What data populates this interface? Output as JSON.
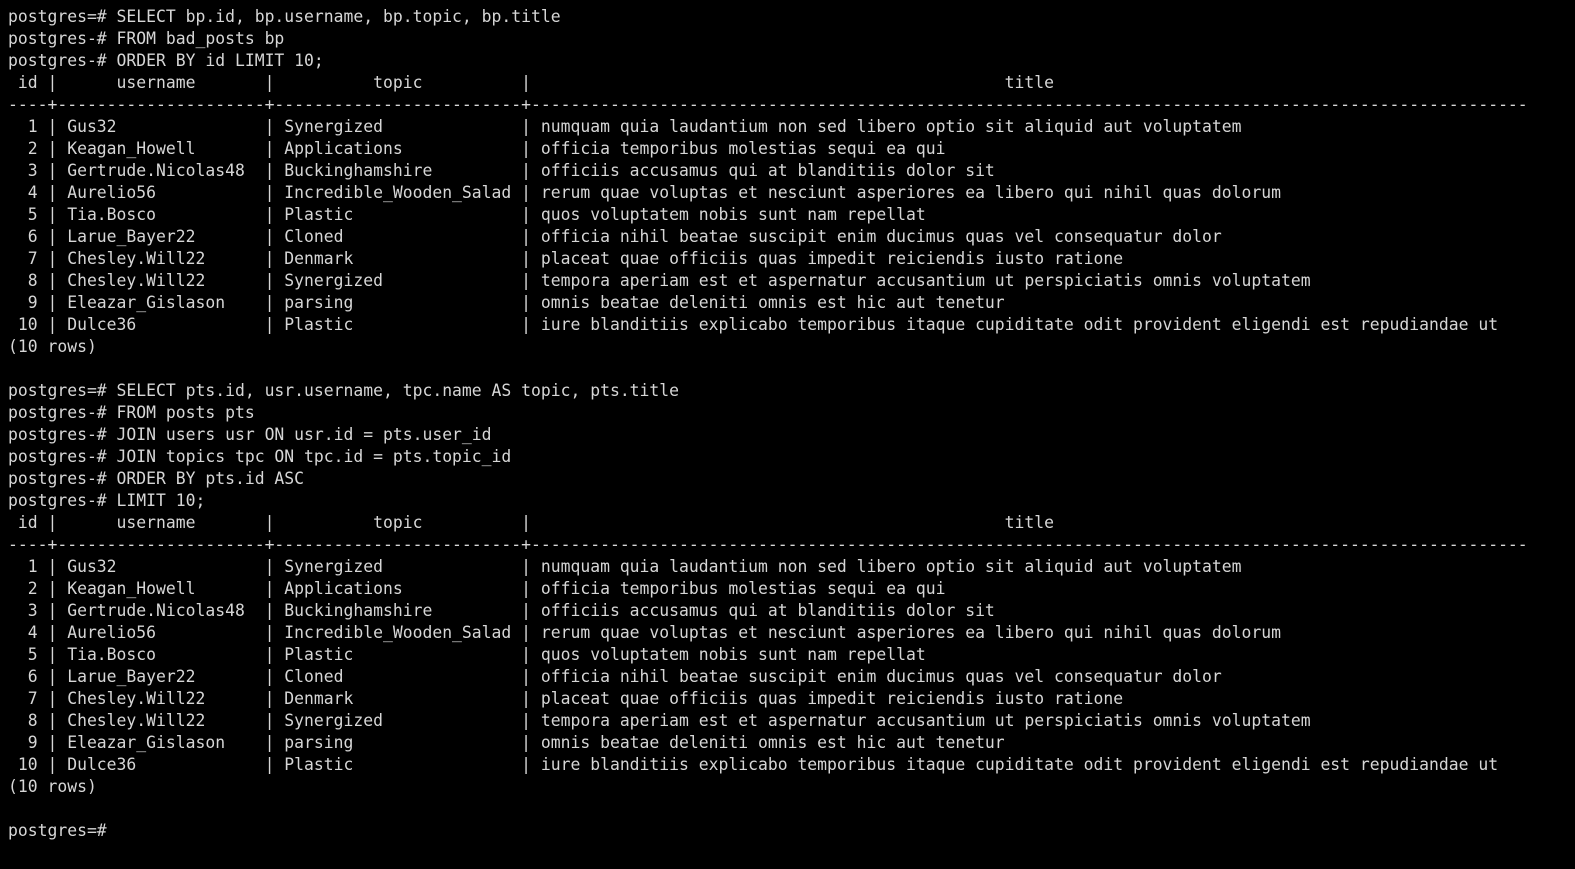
{
  "terminal": {
    "colors": {
      "background": "#000000",
      "foreground": "#d6d6d6"
    },
    "prompt_primary": "postgres=#",
    "prompt_continuation": "postgres-#",
    "column_widths": {
      "id": 4,
      "username": 21,
      "topic": 25
    },
    "separator_total_width": 154
  },
  "blocks": [
    {
      "name": "bad-posts-query",
      "query_lines": [
        "postgres=# SELECT bp.id, bp.username, bp.topic, bp.title",
        "postgres-# FROM bad_posts bp",
        "postgres-# ORDER BY id LIMIT 10;"
      ],
      "result": {
        "headers": [
          "id",
          "username",
          "topic",
          "title"
        ],
        "rows": [
          [
            "1",
            "Gus32",
            "Synergized",
            "numquam quia laudantium non sed libero optio sit aliquid aut voluptatem"
          ],
          [
            "2",
            "Keagan_Howell",
            "Applications",
            "officia temporibus molestias sequi ea qui"
          ],
          [
            "3",
            "Gertrude.Nicolas48",
            "Buckinghamshire",
            "officiis accusamus qui at blanditiis dolor sit"
          ],
          [
            "4",
            "Aurelio56",
            "Incredible_Wooden_Salad",
            "rerum quae voluptas et nesciunt asperiores ea libero qui nihil quas dolorum"
          ],
          [
            "5",
            "Tia.Bosco",
            "Plastic",
            "quos voluptatem nobis sunt nam repellat"
          ],
          [
            "6",
            "Larue_Bayer22",
            "Cloned",
            "officia nihil beatae suscipit enim ducimus quas vel consequatur dolor"
          ],
          [
            "7",
            "Chesley.Will22",
            "Denmark",
            "placeat quae officiis quas impedit reiciendis iusto ratione"
          ],
          [
            "8",
            "Chesley.Will22",
            "Synergized",
            "tempora aperiam est et aspernatur accusantium ut perspiciatis omnis voluptatem"
          ],
          [
            "9",
            "Eleazar_Gislason",
            "parsing",
            "omnis beatae deleniti omnis est hic aut tenetur"
          ],
          [
            "10",
            "Dulce36",
            "Plastic",
            "iure blanditiis explicabo temporibus itaque cupiditate odit provident eligendi est repudiandae ut"
          ]
        ],
        "row_count_label": "(10 rows)"
      }
    },
    {
      "name": "posts-join-query",
      "query_lines": [
        "postgres=# SELECT pts.id, usr.username, tpc.name AS topic, pts.title",
        "postgres-# FROM posts pts",
        "postgres-# JOIN users usr ON usr.id = pts.user_id",
        "postgres-# JOIN topics tpc ON tpc.id = pts.topic_id",
        "postgres-# ORDER BY pts.id ASC",
        "postgres-# LIMIT 10;"
      ],
      "result": {
        "headers": [
          "id",
          "username",
          "topic",
          "title"
        ],
        "rows": [
          [
            "1",
            "Gus32",
            "Synergized",
            "numquam quia laudantium non sed libero optio sit aliquid aut voluptatem"
          ],
          [
            "2",
            "Keagan_Howell",
            "Applications",
            "officia temporibus molestias sequi ea qui"
          ],
          [
            "3",
            "Gertrude.Nicolas48",
            "Buckinghamshire",
            "officiis accusamus qui at blanditiis dolor sit"
          ],
          [
            "4",
            "Aurelio56",
            "Incredible_Wooden_Salad",
            "rerum quae voluptas et nesciunt asperiores ea libero qui nihil quas dolorum"
          ],
          [
            "5",
            "Tia.Bosco",
            "Plastic",
            "quos voluptatem nobis sunt nam repellat"
          ],
          [
            "6",
            "Larue_Bayer22",
            "Cloned",
            "officia nihil beatae suscipit enim ducimus quas vel consequatur dolor"
          ],
          [
            "7",
            "Chesley.Will22",
            "Denmark",
            "placeat quae officiis quas impedit reiciendis iusto ratione"
          ],
          [
            "8",
            "Chesley.Will22",
            "Synergized",
            "tempora aperiam est et aspernatur accusantium ut perspiciatis omnis voluptatem"
          ],
          [
            "9",
            "Eleazar_Gislason",
            "parsing",
            "omnis beatae deleniti omnis est hic aut tenetur"
          ],
          [
            "10",
            "Dulce36",
            "Plastic",
            "iure blanditiis explicabo temporibus itaque cupiditate odit provident eligendi est repudiandae ut"
          ]
        ],
        "row_count_label": "(10 rows)"
      }
    }
  ],
  "final_prompt": "postgres=#"
}
